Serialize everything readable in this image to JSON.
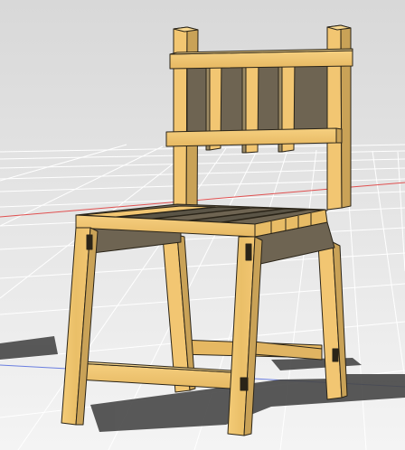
{
  "viewport": {
    "background_top": "#d8d8d8",
    "background_bottom": "#f4f4f4",
    "grid_color": "#ffffff",
    "red_axis_color": "#e05050",
    "blue_axis_color": "#6a7ee0",
    "shadow_color": "#474747"
  },
  "chair": {
    "wood_light": "#f2c872",
    "wood_mid": "#e0b462",
    "wood_dark": "#6e6452",
    "wood_shadow": "#5a5446",
    "edge_color": "#2a2418"
  }
}
